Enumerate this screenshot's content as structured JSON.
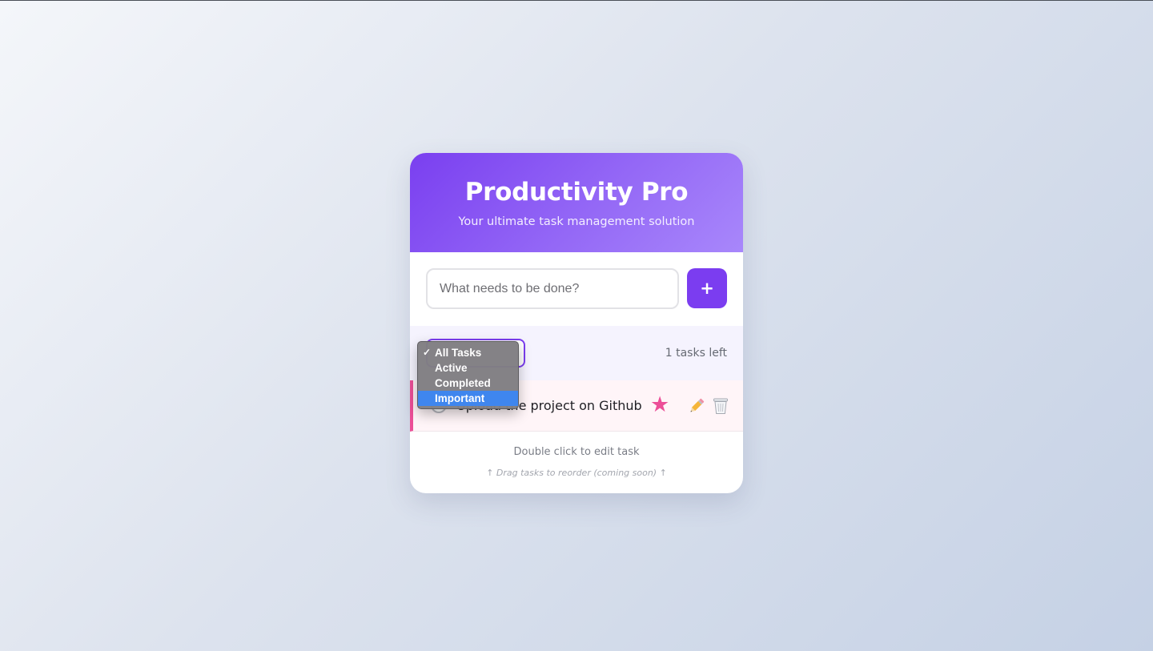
{
  "app": {
    "title": "Productivity Pro",
    "subtitle": "Your ultimate task management solution",
    "accent_color": "#7b3df0",
    "important_color": "#ec4f98"
  },
  "add_task": {
    "input_value": "",
    "placeholder": "What needs to be done?",
    "button_label": "+",
    "button_icon": "plus-icon"
  },
  "filter": {
    "selected": "All Tasks",
    "options": [
      {
        "label": "All Tasks",
        "checked": true,
        "highlighted": false
      },
      {
        "label": "Active",
        "checked": false,
        "highlighted": false
      },
      {
        "label": "Completed",
        "checked": false,
        "highlighted": false
      },
      {
        "label": "Important",
        "checked": false,
        "highlighted": true
      }
    ],
    "checkmark": "✓",
    "tasks_left": "1 tasks left"
  },
  "tasks": [
    {
      "text": "Upload the project on Github",
      "completed": false,
      "important": true,
      "star_icon": "★",
      "edit_icon": "pencil-icon",
      "delete_icon": "trash-icon"
    }
  ],
  "footer": {
    "hint": "Double click to edit task",
    "drag_hint": "↑ Drag tasks to reorder (coming soon) ↑"
  }
}
